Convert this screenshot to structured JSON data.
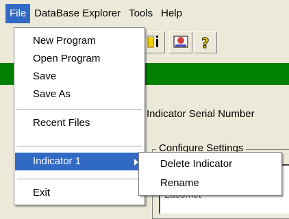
{
  "menubar": {
    "items": [
      "File",
      "DataBase Explorer",
      "Tools",
      "Help"
    ]
  },
  "toolbar": {
    "buttons": [
      "indicator-icon",
      "email-icon",
      "help-icon"
    ]
  },
  "main": {
    "serial_label": "Indicator Serial Number",
    "group_label": "Configure Settings",
    "panel_item": "Lacomet"
  },
  "file_menu": {
    "items": [
      "New Program",
      "Open Program",
      "Save",
      "Save As",
      "Recent Files",
      "Indicator 1",
      "Exit"
    ]
  },
  "indicator_submenu": {
    "items": [
      "Delete Indicator",
      "Rename"
    ]
  },
  "colors": {
    "highlight": "#316ac5",
    "green_bar": "#008000",
    "face": "#ece9d8"
  }
}
